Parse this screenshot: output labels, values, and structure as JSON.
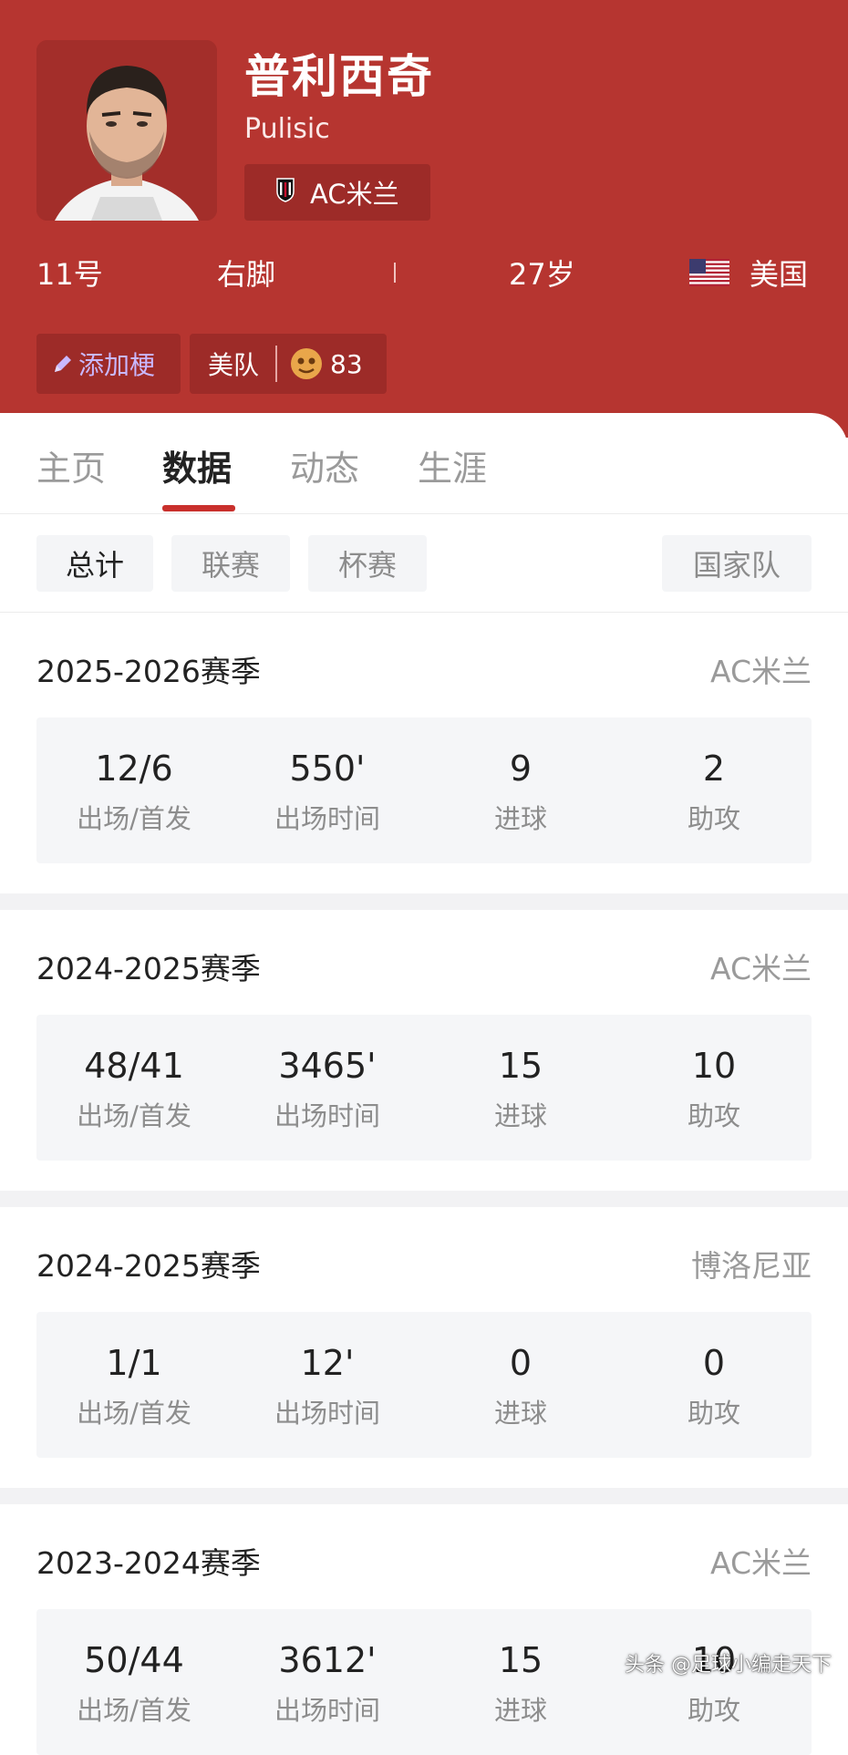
{
  "header": {
    "name_cn": "普利西奇",
    "name_en": "Pulisic",
    "club": "AC米兰",
    "number": "11号",
    "foot": "右脚",
    "age": "27岁",
    "nationality": "美国",
    "add_tag_label": "添加梗",
    "team_tag": "美队",
    "team_score": "83"
  },
  "tabs": [
    {
      "label": "主页",
      "active": false
    },
    {
      "label": "数据",
      "active": true
    },
    {
      "label": "动态",
      "active": false
    },
    {
      "label": "生涯",
      "active": false
    }
  ],
  "filters": [
    {
      "label": "总计",
      "active": true
    },
    {
      "label": "联赛",
      "active": false
    },
    {
      "label": "杯赛",
      "active": false
    },
    {
      "label": "国家队",
      "active": false
    }
  ],
  "seasons": [
    {
      "season": "2025-2026赛季",
      "club": "AC米兰",
      "stats": [
        {
          "value": "12/6",
          "label": "出场/首发"
        },
        {
          "value": "550'",
          "label": "出场时间"
        },
        {
          "value": "9",
          "label": "进球"
        },
        {
          "value": "2",
          "label": "助攻"
        }
      ]
    },
    {
      "season": "2024-2025赛季",
      "club": "AC米兰",
      "stats": [
        {
          "value": "48/41",
          "label": "出场/首发"
        },
        {
          "value": "3465'",
          "label": "出场时间"
        },
        {
          "value": "15",
          "label": "进球"
        },
        {
          "value": "10",
          "label": "助攻"
        }
      ]
    },
    {
      "season": "2024-2025赛季",
      "club": "博洛尼亚",
      "stats": [
        {
          "value": "1/1",
          "label": "出场/首发"
        },
        {
          "value": "12'",
          "label": "出场时间"
        },
        {
          "value": "0",
          "label": "进球"
        },
        {
          "value": "0",
          "label": "助攻"
        }
      ]
    },
    {
      "season": "2023-2024赛季",
      "club": "AC米兰",
      "stats": [
        {
          "value": "50/44",
          "label": "出场/首发"
        },
        {
          "value": "3612'",
          "label": "出场时间"
        },
        {
          "value": "15",
          "label": "进球"
        },
        {
          "value": "10",
          "label": "助攻"
        }
      ]
    }
  ],
  "watermark": "头条 @足球小编走天下",
  "colors": {
    "header_bg": "#b63530",
    "accent": "#c9302c"
  },
  "icons": {
    "club_badge": "ac-milan-badge-icon",
    "flag": "us-flag-icon",
    "edit": "pencil-icon",
    "fan": "fan-face-icon"
  }
}
